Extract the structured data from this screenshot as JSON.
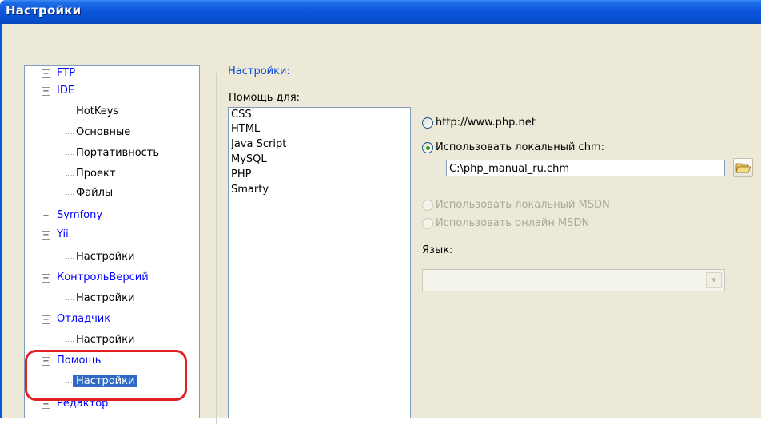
{
  "window": {
    "title": "Настройки"
  },
  "tree": {
    "items": [
      {
        "label": "FTP",
        "type": "node",
        "expander": "+"
      },
      {
        "label": "IDE",
        "type": "node",
        "expander": "−"
      },
      {
        "label": "HotKeys",
        "type": "leaf"
      },
      {
        "label": "Основные",
        "type": "leaf"
      },
      {
        "label": "Портативность",
        "type": "leaf"
      },
      {
        "label": "Проект",
        "type": "leaf"
      },
      {
        "label": "Файлы",
        "type": "leaf"
      },
      {
        "label": "Symfony",
        "type": "node",
        "expander": "+"
      },
      {
        "label": "Yii",
        "type": "node",
        "expander": "−"
      },
      {
        "label": "Настройки",
        "type": "leaf"
      },
      {
        "label": "КонтрольВерсий",
        "type": "node",
        "expander": "−"
      },
      {
        "label": "Настройки",
        "type": "leaf"
      },
      {
        "label": "Отладчик",
        "type": "node",
        "expander": "−"
      },
      {
        "label": "Настройки",
        "type": "leaf"
      },
      {
        "label": "Помощь",
        "type": "node",
        "expander": "−"
      },
      {
        "label": "Настройки",
        "type": "leaf",
        "selected": true
      },
      {
        "label": "Редактор",
        "type": "node",
        "expander": "−"
      }
    ]
  },
  "settings": {
    "group_label": "Настройки:",
    "help_for_label": "Помощь для:",
    "help_for_items": [
      "CSS",
      "HTML",
      "Java Script",
      "MySQL",
      "PHP",
      "Smarty"
    ],
    "selected_help_item": "PHP",
    "options": {
      "php_net": "http://www.php.net",
      "local_chm": "Использовать локальный chm:",
      "chm_path": "C:\\php_manual_ru.chm",
      "local_msdn": "Использовать локальный MSDN",
      "online_msdn": "Использовать онлайн MSDN",
      "selected": "local_chm"
    },
    "language_label": "Язык:",
    "language_value": ""
  },
  "icons": {
    "browse": "folder-open-icon",
    "dropdown": "chevron-down-icon"
  },
  "colors": {
    "title_bar": "#0a55d9",
    "tree_node": "#0000ff",
    "selection": "#316ac5",
    "highlight": "#e02121",
    "group_label": "#0046d5"
  }
}
